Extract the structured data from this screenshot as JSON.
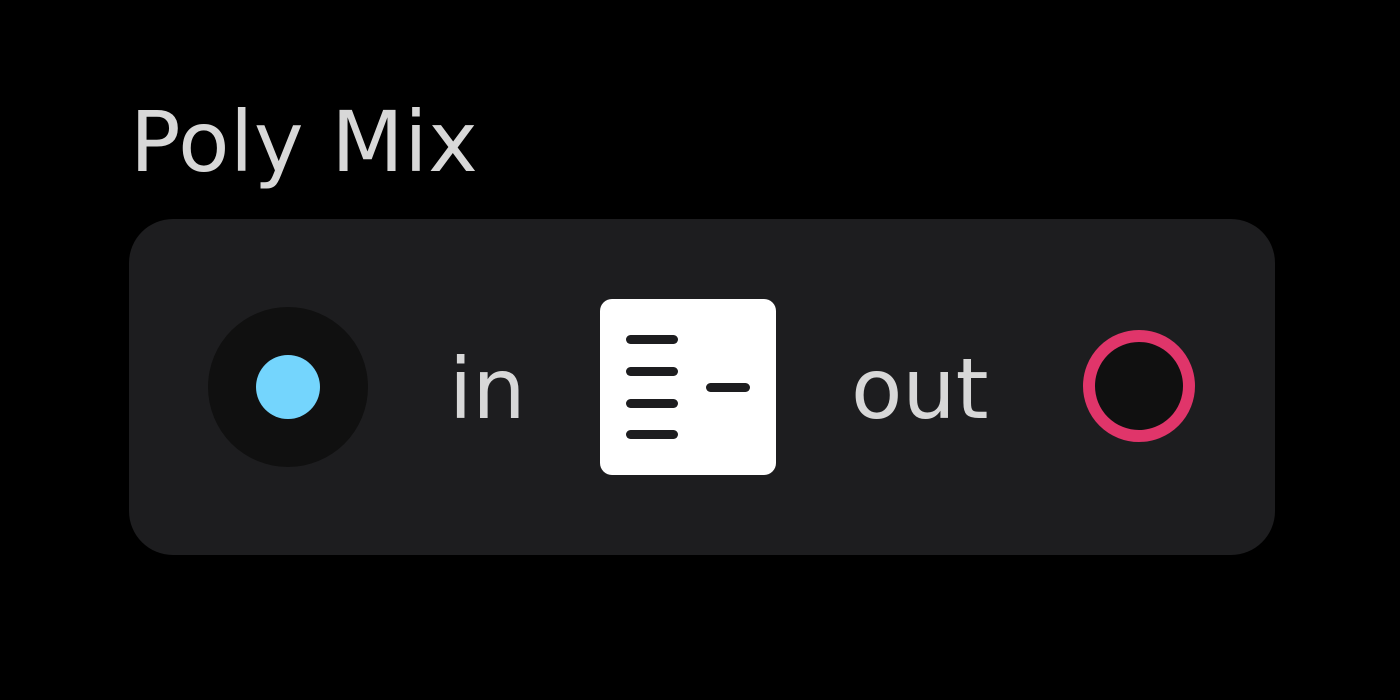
{
  "module": {
    "title": "Poly Mix",
    "input": {
      "label": "in",
      "jack_color": "#74d5fd",
      "icon": "input-jack-icon"
    },
    "output": {
      "label": "out",
      "ring_color": "#e0356a",
      "icon": "output-jack-icon"
    },
    "center_icon": "polyphonic-mix-icon",
    "colors": {
      "background": "#000000",
      "panel": "#1d1d1f",
      "text": "#d8d8d8"
    }
  }
}
